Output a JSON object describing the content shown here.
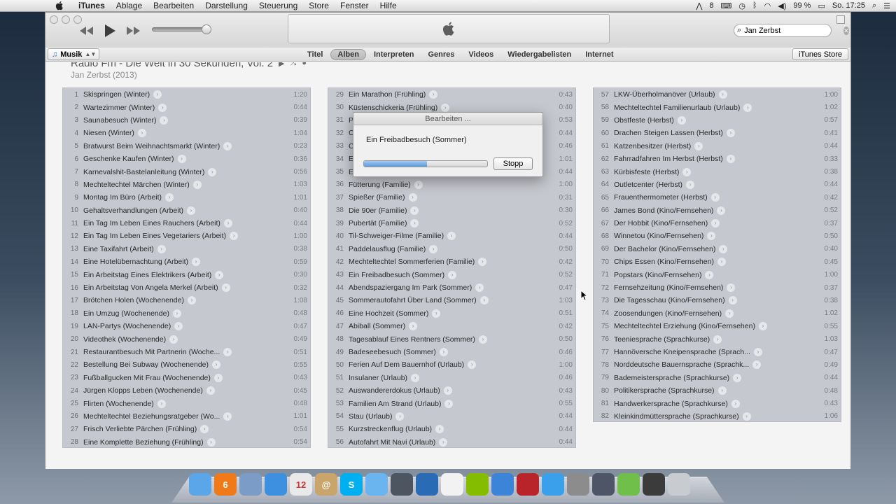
{
  "menubar": {
    "app_name": "iTunes",
    "items": [
      "Ablage",
      "Bearbeiten",
      "Darstellung",
      "Steuerung",
      "Store",
      "Fenster",
      "Hilfe"
    ],
    "status_8": "8",
    "battery": "99 %",
    "clock": "So. 17:25"
  },
  "search": {
    "value": "Jan Zerbst"
  },
  "navbar": {
    "source": "Musik",
    "tabs": [
      "Titel",
      "Alben",
      "Interpreten",
      "Genres",
      "Videos",
      "Wiedergabelisten",
      "Internet"
    ],
    "active_tab": "Alben",
    "store_button": "iTunes Store"
  },
  "album": {
    "title": "Radio Fm - Die Welt in 30 Sekunden, Vol. 2",
    "artist_year": "Jan Zerbst (2013)"
  },
  "dialog": {
    "title": "Bearbeiten ...",
    "message": "Ein Freibadbesuch (Sommer)",
    "progress": 0.51,
    "stop_button": "Stopp"
  },
  "tracks_col1": [
    {
      "n": "1",
      "t": "Skispringen (Winter)",
      "d": "1:20"
    },
    {
      "n": "2",
      "t": "Wartezimmer (Winter)",
      "d": "0:44"
    },
    {
      "n": "3",
      "t": "Saunabesuch (Winter)",
      "d": "0:39"
    },
    {
      "n": "4",
      "t": "Niesen (Winter)",
      "d": "1:04"
    },
    {
      "n": "5",
      "t": "Bratwurst Beim Weihnachtsmarkt (Winter)",
      "d": "0:23"
    },
    {
      "n": "6",
      "t": "Geschenke Kaufen (Winter)",
      "d": "0:36"
    },
    {
      "n": "7",
      "t": "Karnevalshit-Bastelanleitung (Winter)",
      "d": "0:56"
    },
    {
      "n": "8",
      "t": "Mechteltechtel Märchen (Winter)",
      "d": "1:03"
    },
    {
      "n": "9",
      "t": "Montag Im Büro (Arbeit)",
      "d": "1:01"
    },
    {
      "n": "10",
      "t": "Gehaltsverhandlungen (Arbeit)",
      "d": "0:40"
    },
    {
      "n": "11",
      "t": "Ein Tag Im Leben Eines Rauchers (Arbeit)",
      "d": "0:44"
    },
    {
      "n": "12",
      "t": "Ein Tag Im Leben Eines Vegetariers (Arbeit)",
      "d": "1:00"
    },
    {
      "n": "13",
      "t": "Eine Taxifahrt (Arbeit)",
      "d": "0:38"
    },
    {
      "n": "14",
      "t": "Eine Hotelübernachtung (Arbeit)",
      "d": "0:59"
    },
    {
      "n": "15",
      "t": "Ein Arbeitstag Eines Elektrikers (Arbeit)",
      "d": "0:30"
    },
    {
      "n": "16",
      "t": "Ein Arbeitstag Von Angela Merkel (Arbeit)",
      "d": "0:32"
    },
    {
      "n": "17",
      "t": "Brötchen Holen (Wochenende)",
      "d": "1:08"
    },
    {
      "n": "18",
      "t": "Ein Umzug (Wochenende)",
      "d": "0:48"
    },
    {
      "n": "19",
      "t": "LAN-Partys (Wochenende)",
      "d": "0:47"
    },
    {
      "n": "20",
      "t": "Videothek (Wochenende)",
      "d": "0:49"
    },
    {
      "n": "21",
      "t": "Restaurantbesuch Mit Partnerin (Woche...",
      "d": "0:51"
    },
    {
      "n": "22",
      "t": "Bestellung Bei Subway (Wochenende)",
      "d": "0:55"
    },
    {
      "n": "23",
      "t": "Fußballgucken Mit Frau (Wochenende)",
      "d": "0:43"
    },
    {
      "n": "24",
      "t": "Jürgen Klopps Leben (Wochenende)",
      "d": "0:45"
    },
    {
      "n": "25",
      "t": "Flirten (Wochenende)",
      "d": "0:48"
    },
    {
      "n": "26",
      "t": "Mechteltechtel Beziehungsratgeber (Wo...",
      "d": "1:01"
    },
    {
      "n": "27",
      "t": "Frisch Verliebte Pärchen (Frühling)",
      "d": "0:54"
    },
    {
      "n": "28",
      "t": "Eine Komplette Beziehung (Frühling)",
      "d": "0:54"
    }
  ],
  "tracks_col2": [
    {
      "n": "29",
      "t": "Ein Marathon (Frühling)",
      "d": "0:43"
    },
    {
      "n": "30",
      "t": "Küstenschickeria (Frühling)",
      "d": "0:40"
    },
    {
      "n": "31",
      "t": "P",
      "d": "0:53"
    },
    {
      "n": "32",
      "t": "C",
      "d": "0:44"
    },
    {
      "n": "33",
      "t": "C",
      "d": "0:46"
    },
    {
      "n": "34",
      "t": "E",
      "d": "1:01"
    },
    {
      "n": "35",
      "t": "E",
      "d": "0:44"
    },
    {
      "n": "36",
      "t": "Fütterung (Familie)",
      "d": "1:00"
    },
    {
      "n": "37",
      "t": "Spießer (Familie)",
      "d": "0:31"
    },
    {
      "n": "38",
      "t": "Die 90er (Familie)",
      "d": "0:30"
    },
    {
      "n": "39",
      "t": "Pubertät (Familie)",
      "d": "0:52"
    },
    {
      "n": "40",
      "t": "Til-Schweiger-Filme (Familie)",
      "d": "0:44"
    },
    {
      "n": "41",
      "t": "Paddelausflug (Familie)",
      "d": "0:50"
    },
    {
      "n": "42",
      "t": "Mechteltechtel Sommerferien (Familie)",
      "d": "0:42"
    },
    {
      "n": "43",
      "t": "Ein Freibadbesuch (Sommer)",
      "d": "0:52"
    },
    {
      "n": "44",
      "t": "Abendspaziergang Im Park (Sommer)",
      "d": "0:47"
    },
    {
      "n": "45",
      "t": "Sommerautofahrt Über Land (Sommer)",
      "d": "1:03"
    },
    {
      "n": "46",
      "t": "Eine Hochzeit (Sommer)",
      "d": "0:51"
    },
    {
      "n": "47",
      "t": "Abiball (Sommer)",
      "d": "0:42"
    },
    {
      "n": "48",
      "t": "Tagesablauf Eines Rentners (Sommer)",
      "d": "0:50"
    },
    {
      "n": "49",
      "t": "Badeseebesuch (Sommer)",
      "d": "0:46"
    },
    {
      "n": "50",
      "t": "Ferien Auf Dem Bauernhof (Urlaub)",
      "d": "1:00"
    },
    {
      "n": "51",
      "t": "Insulaner (Urlaub)",
      "d": "0:46"
    },
    {
      "n": "52",
      "t": "Auswandererdokus (Urlaub)",
      "d": "0:43"
    },
    {
      "n": "53",
      "t": "Familien Am Strand (Urlaub)",
      "d": "0:55"
    },
    {
      "n": "54",
      "t": "Stau (Urlaub)",
      "d": "0:44"
    },
    {
      "n": "55",
      "t": "Kurzstreckenflug (Urlaub)",
      "d": "0:44"
    },
    {
      "n": "56",
      "t": "Autofahrt Mit Navi (Urlaub)",
      "d": "0:44"
    }
  ],
  "tracks_col3": [
    {
      "n": "57",
      "t": "LKW-Überholmanöver (Urlaub)",
      "d": "1:00"
    },
    {
      "n": "58",
      "t": "Mechteltechtel Familienurlaub (Urlaub)",
      "d": "1:02"
    },
    {
      "n": "59",
      "t": "Obstfeste (Herbst)",
      "d": "0:57"
    },
    {
      "n": "60",
      "t": "Drachen Steigen Lassen (Herbst)",
      "d": "0:41"
    },
    {
      "n": "61",
      "t": "Katzenbesitzer (Herbst)",
      "d": "0:44"
    },
    {
      "n": "62",
      "t": "Fahrradfahren Im Herbst (Herbst)",
      "d": "0:33"
    },
    {
      "n": "63",
      "t": "Kürbisfeste (Herbst)",
      "d": "0:38"
    },
    {
      "n": "64",
      "t": "Outletcenter (Herbst)",
      "d": "0:44"
    },
    {
      "n": "65",
      "t": "Frauenthermometer (Herbst)",
      "d": "0:42"
    },
    {
      "n": "66",
      "t": "James Bond (Kino/Fernsehen)",
      "d": "0:52"
    },
    {
      "n": "67",
      "t": "Der Hobbit (Kino/Fernsehen)",
      "d": "0:37"
    },
    {
      "n": "68",
      "t": "Winnetou (Kino/Fernsehen)",
      "d": "0:50"
    },
    {
      "n": "69",
      "t": "Der Bachelor (Kino/Fernsehen)",
      "d": "0:40"
    },
    {
      "n": "70",
      "t": "Chips Essen (Kino/Fernsehen)",
      "d": "0:45"
    },
    {
      "n": "71",
      "t": "Popstars (Kino/Fernsehen)",
      "d": "1:00"
    },
    {
      "n": "72",
      "t": "Fernsehzeitung (Kino/Fernsehen)",
      "d": "0:37"
    },
    {
      "n": "73",
      "t": "Die Tagesschau (Kino/Fernsehen)",
      "d": "0:38"
    },
    {
      "n": "74",
      "t": "Zoosendungen (Kino/Fernsehen)",
      "d": "1:02"
    },
    {
      "n": "75",
      "t": "Mechteltechtel Erziehung (Kino/Fernsehen)",
      "d": "0:55"
    },
    {
      "n": "76",
      "t": "Teeniesprache (Sprachkurse)",
      "d": "1:03"
    },
    {
      "n": "77",
      "t": "Hannöversche Kneipensprache (Sprach...",
      "d": "0:47"
    },
    {
      "n": "78",
      "t": "Norddeutsche Bauernsprache (Sprachk...",
      "d": "0:49"
    },
    {
      "n": "79",
      "t": "Bademeistersprache (Sprachkurse)",
      "d": "0:44"
    },
    {
      "n": "80",
      "t": "Politikersprache (Sprachkurse)",
      "d": "0:48"
    },
    {
      "n": "81",
      "t": "Handwerkersprache (Sprachkurse)",
      "d": "0:43"
    },
    {
      "n": "82",
      "t": "Kleinkindmüttersprache (Sprachkurse)",
      "d": "1:06"
    }
  ],
  "dock": {
    "items": [
      {
        "name": "finder",
        "label": "",
        "color": "#5aa6e8"
      },
      {
        "name": "app-6",
        "label": "6",
        "color": "#f07a1a"
      },
      {
        "name": "mail",
        "label": "",
        "color": "#7a9cc6"
      },
      {
        "name": "safari",
        "label": "",
        "color": "#3d8fdf"
      },
      {
        "name": "calendar",
        "label": "12",
        "color": "#e9e9e9"
      },
      {
        "name": "contacts",
        "label": "@",
        "color": "#c9a56b"
      },
      {
        "name": "skype",
        "label": "S",
        "color": "#00aff0"
      },
      {
        "name": "messages",
        "label": "",
        "color": "#6ab4f0"
      },
      {
        "name": "facetime",
        "label": "",
        "color": "#4c5560"
      },
      {
        "name": "virtualbox",
        "label": "",
        "color": "#2a6bb5"
      },
      {
        "name": "textedit",
        "label": "",
        "color": "#f2f2f2"
      },
      {
        "name": "spotify",
        "label": "",
        "color": "#84bd00"
      },
      {
        "name": "itunes",
        "label": "",
        "color": "#3b84d8"
      },
      {
        "name": "photo-booth",
        "label": "",
        "color": "#b8242a"
      },
      {
        "name": "app-store",
        "label": "",
        "color": "#3aa0ec"
      },
      {
        "name": "system-preferences",
        "label": "",
        "color": "#8c8c8c"
      },
      {
        "name": "imovie",
        "label": "",
        "color": "#4e5566"
      },
      {
        "name": "automator",
        "label": "",
        "color": "#6fbf4a"
      },
      {
        "name": "utilities",
        "label": "",
        "color": "#3b3b3b"
      },
      {
        "name": "trash",
        "label": "",
        "color": "#c8cbd0"
      }
    ]
  }
}
